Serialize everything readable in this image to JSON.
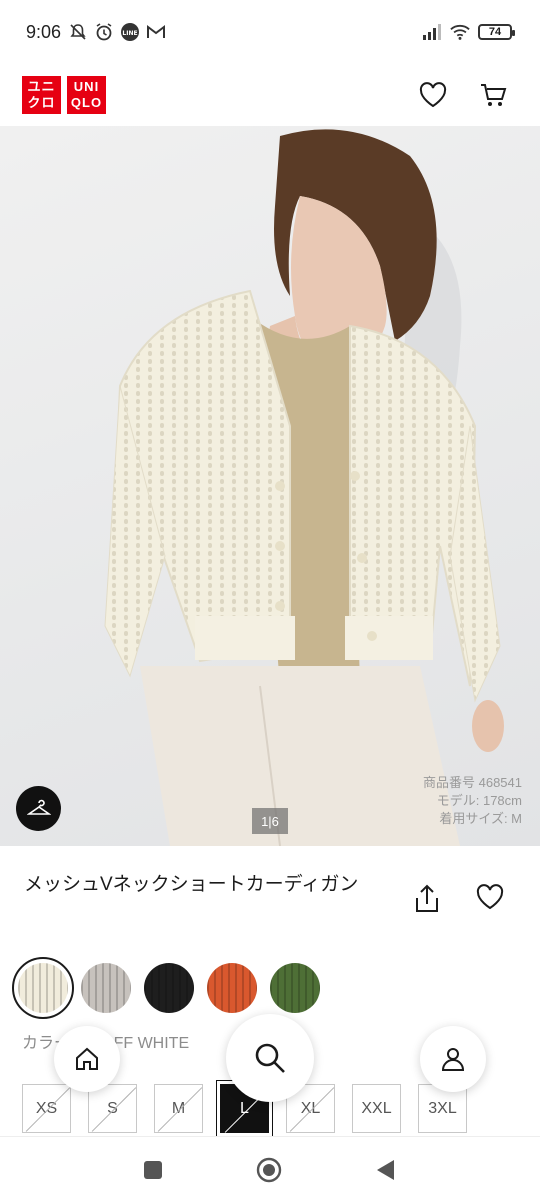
{
  "status_bar": {
    "time": "9:06",
    "battery": "74",
    "left_icons": [
      "mute-icon",
      "alarm-icon",
      "line-icon",
      "gmail-icon"
    ],
    "right_icons": [
      "signal-icon",
      "wifi-icon",
      "battery-icon"
    ]
  },
  "header": {
    "logo_top_left": "ユニ",
    "logo_bottom_left": "クロ",
    "logo_top_right": "UNI",
    "logo_bottom_right": "QLO",
    "brand_color": "#e60012",
    "icons": [
      "heart-icon",
      "cart-icon"
    ]
  },
  "product_image": {
    "item_number": "商品番号 468541",
    "model_height": "モデル: 178cm",
    "wear_size": "着用サイズ: M",
    "pager": "1|6"
  },
  "product": {
    "title": "メッシュVネックショートカーディガン"
  },
  "colors": {
    "label": "カラー: 01 OFF WHITE",
    "swatches": [
      {
        "name": "OFF WHITE",
        "hex": "#f1ecdc",
        "selected": true
      },
      {
        "name": "LIGHT GRAY",
        "hex": "#c7c2bd",
        "selected": false
      },
      {
        "name": "BLACK",
        "hex": "#1e1e1e",
        "selected": false
      },
      {
        "name": "ORANGE",
        "hex": "#d9582e",
        "selected": false
      },
      {
        "name": "OLIVE",
        "hex": "#4e6f36",
        "selected": false
      }
    ]
  },
  "sizes": [
    {
      "label": "XS",
      "available": false,
      "selected": false
    },
    {
      "label": "S",
      "available": false,
      "selected": false
    },
    {
      "label": "M",
      "available": false,
      "selected": false
    },
    {
      "label": "L",
      "available": false,
      "selected": true
    },
    {
      "label": "XL",
      "available": false,
      "selected": false
    },
    {
      "label": "XXL",
      "available": true,
      "selected": false
    },
    {
      "label": "3XL",
      "available": true,
      "selected": false
    }
  ],
  "floating_nav": [
    "home-icon",
    "search-icon",
    "account-icon"
  ]
}
